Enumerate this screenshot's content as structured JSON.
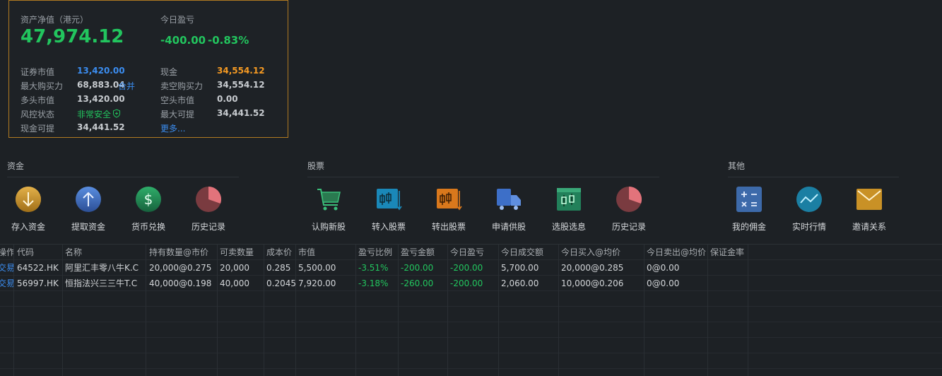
{
  "summary": {
    "net_asset_label": "资产净值（港元）",
    "net_asset_value": "47,974.12",
    "today_pl_label": "今日盈亏",
    "today_pl_amount": "-400.00",
    "today_pl_pct": "-0.83%",
    "rows_left": [
      {
        "label": "证券市值",
        "value": "13,420.00"
      },
      {
        "label": "最大购买力",
        "value": "68,883.04",
        "extra": "合并"
      },
      {
        "label": "多头市值",
        "value": "13,420.00"
      },
      {
        "label": "风控状态",
        "value": "非常安全"
      },
      {
        "label": "现金可提",
        "value": "34,441.52"
      }
    ],
    "rows_right": [
      {
        "label": "现金",
        "value": "34,554.12"
      },
      {
        "label": "卖空购买力",
        "value": "34,554.12"
      },
      {
        "label": "空头市值",
        "value": "0.00"
      },
      {
        "label": "最大可提",
        "value": "34,441.52"
      },
      {
        "label": "更多...",
        "value": ""
      }
    ],
    "colors": {
      "positive_green": "#22c55e",
      "accent_blue": "#3b8df0",
      "cash_orange": "#f59a23",
      "border": "#b07a22"
    }
  },
  "sections": {
    "funds": {
      "title": "资金",
      "buttons": [
        {
          "label": "存入资金",
          "icon": "deposit-icon"
        },
        {
          "label": "提取资金",
          "icon": "withdraw-icon"
        },
        {
          "label": "货币兑换",
          "icon": "currency-exchange-icon"
        },
        {
          "label": "历史记录",
          "icon": "history-pie-icon"
        }
      ]
    },
    "stocks": {
      "title": "股票",
      "buttons": [
        {
          "label": "认购新股",
          "icon": "ipo-cart-icon"
        },
        {
          "label": "转入股票",
          "icon": "transfer-in-icon"
        },
        {
          "label": "转出股票",
          "icon": "transfer-out-icon"
        },
        {
          "label": "申请供股",
          "icon": "rights-issue-truck-icon"
        },
        {
          "label": "选股选息",
          "icon": "stock-dividend-icon"
        },
        {
          "label": "历史记录",
          "icon": "history-pie-icon"
        }
      ]
    },
    "other": {
      "title": "其他",
      "buttons": [
        {
          "label": "我的佣金",
          "icon": "calculator-icon"
        },
        {
          "label": "实时行情",
          "icon": "realtime-chart-icon"
        },
        {
          "label": "邀请关系",
          "icon": "invite-mail-icon"
        }
      ]
    }
  },
  "table": {
    "headers": [
      "操作",
      "代码",
      "名称",
      "持有数量@市价",
      "可卖数量",
      "成本价",
      "市值",
      "盈亏比例",
      "盈亏金额",
      "今日盈亏",
      "今日成交额",
      "今日买入@均价",
      "今日卖出@均价",
      "保证金率"
    ],
    "rows": [
      [
        "交易",
        "64522.HK",
        "阿里汇丰零八牛K.C",
        "20,000@0.275",
        "20,000",
        "0.285",
        "5,500.00",
        "-3.51%",
        "-200.00",
        "-200.00",
        "5,700.00",
        "20,000@0.285",
        "0@0.00",
        ""
      ],
      [
        "交易",
        "56997.HK",
        "恒指法兴三三牛T.C",
        "40,000@0.198",
        "40,000",
        "0.2045",
        "7,920.00",
        "-3.18%",
        "-260.00",
        "-200.00",
        "2,060.00",
        "10,000@0.206",
        "0@0.00",
        ""
      ]
    ]
  }
}
